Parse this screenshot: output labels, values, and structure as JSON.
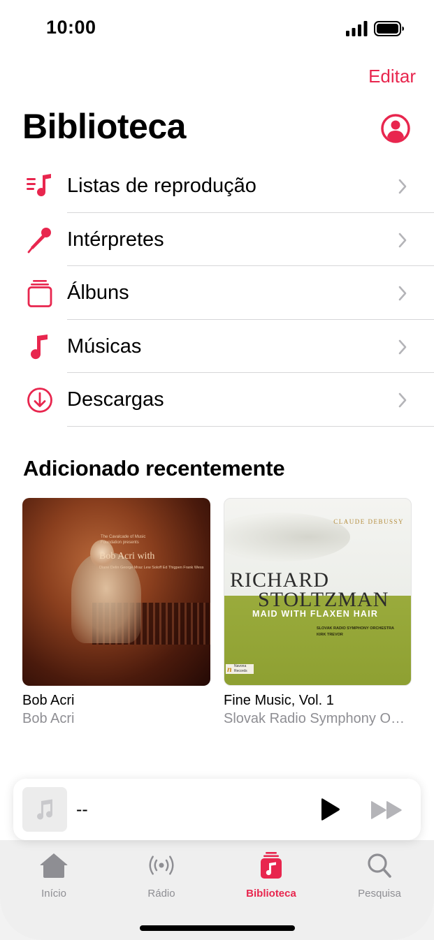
{
  "status_bar": {
    "time": "10:00"
  },
  "header": {
    "edit_label": "Editar",
    "title": "Biblioteca"
  },
  "library": {
    "items": [
      {
        "label": "Listas de reprodução",
        "icon": "playlist-icon"
      },
      {
        "label": "Intérpretes",
        "icon": "microphone-icon"
      },
      {
        "label": "Álbuns",
        "icon": "album-stack-icon"
      },
      {
        "label": "Músicas",
        "icon": "music-note-icon"
      },
      {
        "label": "Descargas",
        "icon": "download-circle-icon"
      }
    ]
  },
  "recently_added": {
    "title": "Adicionado recentemente",
    "albums": [
      {
        "title": "Bob Acri",
        "artist": "Bob Acri",
        "art": {
          "small_text": "The Cavalcade of Music Foundation presents",
          "name": "Bob Acri with",
          "with": "Diane Delin George Mraz Lew Soloff Ed Thigpen Frank Wess"
        }
      },
      {
        "title": "Fine Music, Vol. 1",
        "artist": "Slovak Radio Symphony O…",
        "art": {
          "composer": "CLAUDE DEBUSSY",
          "line1": "RICHARD",
          "line2": "STOLTZMAN",
          "subtitle": "MAID WITH FLAXEN HAIR",
          "orchestra": "SLOVAK RADIO SYMPHONY ORCHESTRA",
          "conductor": "KIRK TREVOR",
          "label_mark": "n",
          "label_text": "Navona Records"
        }
      }
    ]
  },
  "mini_player": {
    "title": "--"
  },
  "tabs": [
    {
      "label": "Início",
      "icon": "home-icon"
    },
    {
      "label": "Rádio",
      "icon": "radio-icon"
    },
    {
      "label": "Biblioteca",
      "icon": "library-icon",
      "active": true
    },
    {
      "label": "Pesquisa",
      "icon": "search-icon"
    }
  ],
  "colors": {
    "accent": "#e8264e",
    "secondary_text": "#8e8e93",
    "tab_bar": "#efefef"
  }
}
